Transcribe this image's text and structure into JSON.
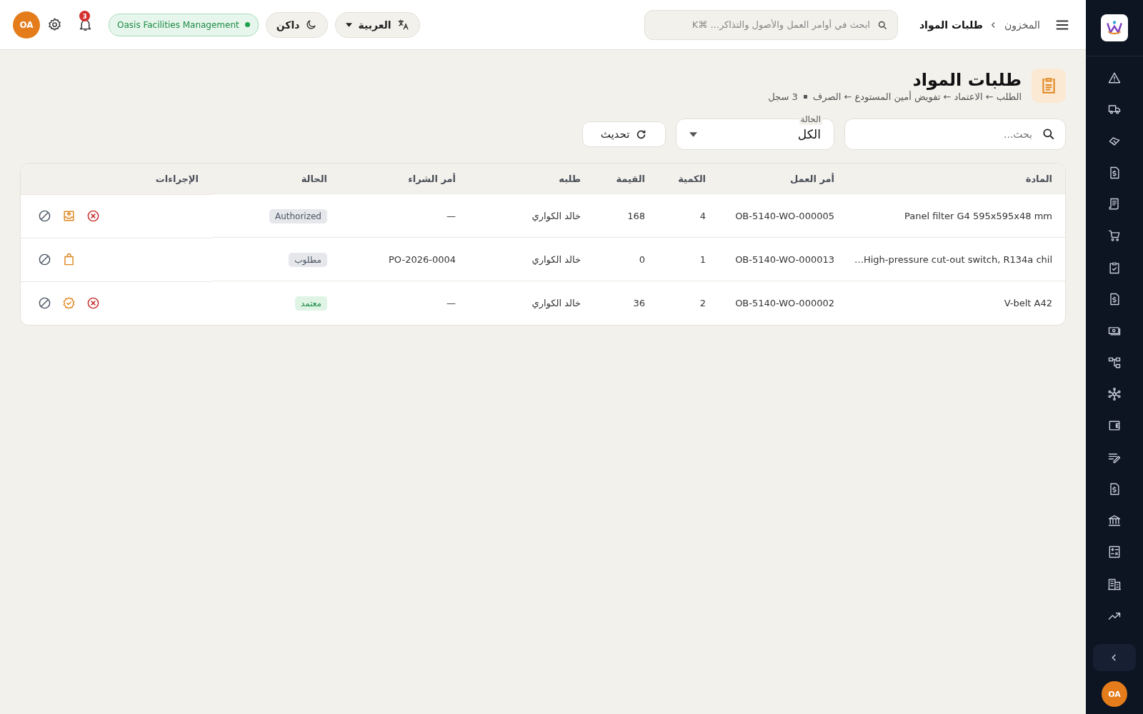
{
  "topbar": {
    "breadcrumb": [
      {
        "label": "المخزون",
        "current": false
      },
      {
        "label": "طلبات المواد",
        "current": true
      }
    ],
    "search": {
      "placeholder": "ابحث في أوامر العمل والأصول والتذاكر... ⌘K"
    },
    "language": "العربية",
    "theme": "داكن",
    "organization": "Oasis Facilities Management",
    "notifications": "3",
    "user_initials": "OA"
  },
  "page": {
    "title": "طلبات المواد",
    "subtitle": "الطلب ← الاعتماد ← تفويض أمين المستودع ← الصرف",
    "record_count": "3 سجل"
  },
  "filters": {
    "search": {
      "placeholder": "بحث..."
    },
    "status": {
      "label": "الحالة",
      "value": "الكل"
    },
    "refresh": "تحديث"
  },
  "table": {
    "columns": [
      "المادة",
      "أمر العمل",
      "الكمية",
      "القيمة",
      "طلبه",
      "أمر الشراء",
      "الحالة",
      "الإجراءات"
    ],
    "rows": [
      {
        "material": "Panel filter G4 595x595x48 mm",
        "work_order": "OB-5140-WO-000005",
        "quantity": "4",
        "value": "168",
        "requester": "خالد الكواري",
        "purchase_order": "—",
        "status": {
          "label": "Authorized",
          "kind": "neutral"
        },
        "actions": [
          {
            "kind": "cancel"
          },
          {
            "kind": "issue"
          },
          {
            "kind": "block"
          }
        ]
      },
      {
        "material": "High-pressure cut-out switch, R134a chil…",
        "work_order": "OB-5140-WO-000013",
        "quantity": "1",
        "value": "0",
        "requester": "خالد الكواري",
        "purchase_order": "PO-2026-0004",
        "status": {
          "label": "مطلوب",
          "kind": "neutral"
        },
        "actions": [
          {
            "kind": "purchase"
          },
          {
            "kind": "block"
          }
        ]
      },
      {
        "material": "V-belt A42",
        "work_order": "OB-5140-WO-000002",
        "quantity": "2",
        "value": "36",
        "requester": "خالد الكواري",
        "purchase_order": "—",
        "status": {
          "label": "معتمد",
          "kind": "success"
        },
        "actions": [
          {
            "kind": "cancel"
          },
          {
            "kind": "approve"
          },
          {
            "kind": "block"
          }
        ]
      }
    ]
  },
  "sidebar": {
    "user_initials": "OA"
  }
}
